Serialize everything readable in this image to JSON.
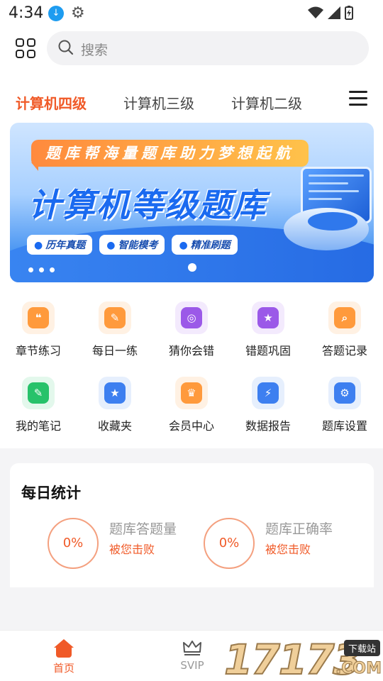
{
  "status": {
    "time": "4:34"
  },
  "search": {
    "placeholder": "搜索"
  },
  "tabs": [
    {
      "label": "计算机四级",
      "active": true
    },
    {
      "label": "计算机三级",
      "active": false
    },
    {
      "label": "计算机二级",
      "active": false
    }
  ],
  "banner": {
    "ribbon": "题库帮海量题库助力梦想起航",
    "title": "计算机等级题库",
    "pills": [
      "历年真题",
      "智能模考",
      "精准刷题"
    ]
  },
  "features": [
    {
      "label": "章节练习",
      "icon": "chapter-icon",
      "color": "#ff9a3c",
      "bg": "#fff1e3"
    },
    {
      "label": "每日一练",
      "icon": "daily-icon",
      "color": "#ff9a3c",
      "bg": "#fff1e3"
    },
    {
      "label": "猜你会错",
      "icon": "target-icon",
      "color": "#9b59e8",
      "bg": "#f3eafd"
    },
    {
      "label": "错题巩固",
      "icon": "folder-star-icon",
      "color": "#9b59e8",
      "bg": "#f3eafd"
    },
    {
      "label": "答题记录",
      "icon": "record-icon",
      "color": "#ff9a3c",
      "bg": "#fff1e3"
    },
    {
      "label": "我的笔记",
      "icon": "note-icon",
      "color": "#27c26a",
      "bg": "#e3f8ec"
    },
    {
      "label": "收藏夹",
      "icon": "favorite-icon",
      "color": "#3d7ff0",
      "bg": "#e6effd"
    },
    {
      "label": "会员中心",
      "icon": "crown-icon",
      "color": "#ff9a3c",
      "bg": "#fff1e3"
    },
    {
      "label": "数据报告",
      "icon": "lightning-icon",
      "color": "#3d7ff0",
      "bg": "#e6effd"
    },
    {
      "label": "题库设置",
      "icon": "settings-icon",
      "color": "#3d7ff0",
      "bg": "#e6effd"
    }
  ],
  "daily": {
    "heading": "每日统计",
    "items": [
      {
        "value": "0%",
        "title": "题库答题量",
        "sub": "被您击败"
      },
      {
        "value": "0%",
        "title": "题库正确率",
        "sub": "被您击败"
      }
    ]
  },
  "bottom_nav": [
    {
      "label": "首页",
      "active": true,
      "icon": "home-icon"
    },
    {
      "label": "SVIP",
      "active": false,
      "icon": "crown-icon"
    }
  ],
  "watermark": {
    "number": "17173",
    "tag": "下载站",
    "domain": ".COM"
  },
  "colors": {
    "accent": "#f05a28",
    "banner_blue": "#1a6af0"
  }
}
